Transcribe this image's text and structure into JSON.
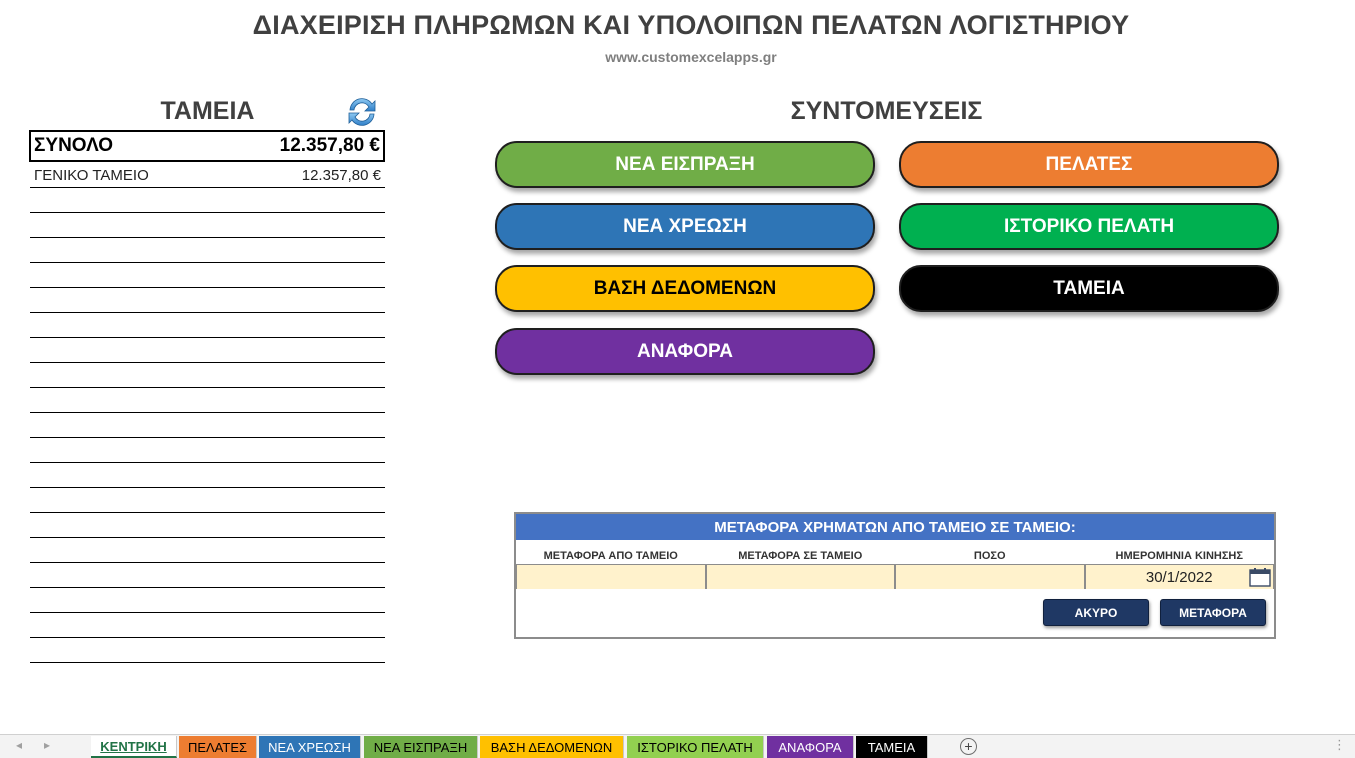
{
  "header": {
    "title": "ΔΙΑΧΕΙΡΙΣΗ ΠΛΗΡΩΜΩΝ ΚΑΙ ΥΠΟΛΟΙΠΩΝ ΠΕΛΑΤΩΝ ΛΟΓΙΣΤΗΡΙΟΥ",
    "website": "www.customexcelapps.gr"
  },
  "cash": {
    "heading": "ΤΑΜΕΙΑ",
    "refresh_icon": "refresh-icon",
    "total_label": "ΣΥΝΟΛΟ",
    "total_value": "12.357,80 €",
    "rows": [
      {
        "name": "ΓΕΝΙΚΟ ΤΑΜΕΙΟ",
        "value": "12.357,80 €"
      }
    ],
    "empty_rows": 19
  },
  "shortcuts": {
    "heading": "ΣΥΝΤΟΜΕΥΣΕΙΣ",
    "buttons": [
      {
        "label": "ΝΕΑ ΕΙΣΠΡΑΞΗ",
        "color": "#70ad47",
        "text_color": "#ffffff"
      },
      {
        "label": "ΠΕΛΑΤΕΣ",
        "color": "#ed7d31",
        "text_color": "#ffffff"
      },
      {
        "label": "ΝΕΑ ΧΡΕΩΣΗ",
        "color": "#2e75b6",
        "text_color": "#ffffff"
      },
      {
        "label": "ΙΣΤΟΡΙΚΟ ΠΕΛΑΤΗ",
        "color": "#00b050",
        "text_color": "#ffffff"
      },
      {
        "label": "ΒΑΣΗ ΔΕΔΟΜΕΝΩΝ",
        "color": "#ffc000",
        "text_color": "#000000"
      },
      {
        "label": "ΤΑΜΕΙΑ",
        "color": "#000000",
        "text_color": "#ffffff"
      },
      {
        "label": "ΑΝΑΦΟΡΑ",
        "color": "#7030a0",
        "text_color": "#ffffff"
      }
    ]
  },
  "transfer": {
    "title": "ΜΕΤΑΦΟΡΑ ΧΡΗΜΑΤΩΝ ΑΠΟ ΤΑΜΕΙΟ ΣΕ ΤΑΜΕΙΟ:",
    "from_label": "ΜΕΤΑΦΟΡΑ ΑΠΟ ΤΑΜΕΙΟ",
    "to_label": "ΜΕΤΑΦΟΡΑ ΣΕ ΤΑΜΕΙΟ",
    "amount_label": "ΠΟΣΟ",
    "date_label": "ΗΜΕΡΟΜΗΝΙΑ ΚΙΝΗΣΗΣ",
    "from_value": "",
    "to_value": "",
    "amount_value": "",
    "date_value": "30/1/2022",
    "calendar_icon": "calendar-icon",
    "cancel_label": "ΑΚΥΡΟ",
    "transfer_label": "ΜΕΤΑΦΟΡΑ",
    "header_color": "#4472c4",
    "input_color": "#fff2cc",
    "button_color": "#1f3864"
  },
  "sheet_tabs": [
    {
      "label": "ΚΕΝΤΡΙΚΗ",
      "active": true,
      "color": "#ffffff",
      "text_color": "#217346"
    },
    {
      "label": "ΠΕΛΑΤΕΣ",
      "active": false,
      "color": "#ed7d31",
      "text_color": "#000000"
    },
    {
      "label": "ΝΕΑ ΧΡΕΩΣΗ",
      "active": false,
      "color": "#2e75b6",
      "text_color": "#ffffff"
    },
    {
      "label": "ΝΕΑ ΕΙΣΠΡΑΞΗ",
      "active": false,
      "color": "#70ad47",
      "text_color": "#000000"
    },
    {
      "label": "ΒΑΣΗ ΔΕΔΟΜΕΝΩΝ",
      "active": false,
      "color": "#ffc000",
      "text_color": "#000000"
    },
    {
      "label": "ΙΣΤΟΡΙΚΟ ΠΕΛΑΤΗ",
      "active": false,
      "color": "#92d050",
      "text_color": "#000000"
    },
    {
      "label": "ΑΝΑΦΟΡΑ",
      "active": false,
      "color": "#7030a0",
      "text_color": "#ffffff"
    },
    {
      "label": "ΤΑΜΕΙΑ",
      "active": false,
      "color": "#000000",
      "text_color": "#ffffff"
    }
  ]
}
